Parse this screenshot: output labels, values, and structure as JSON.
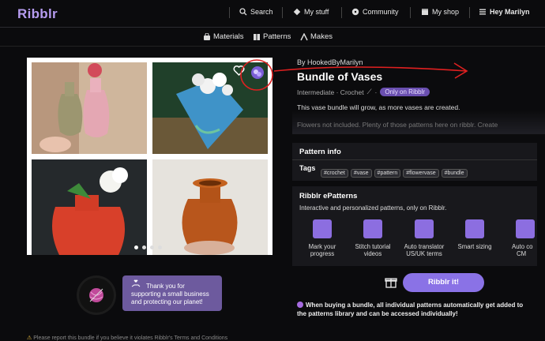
{
  "app": {
    "logo": "Ribblr"
  },
  "topnav": [
    {
      "label": "Search",
      "icon": "search-icon"
    },
    {
      "label": "My stuff",
      "icon": "stuff-icon"
    },
    {
      "label": "Community",
      "icon": "chat-icon"
    },
    {
      "label": "My shop",
      "icon": "shop-icon"
    },
    {
      "label": "Hey Marilyn",
      "icon": "menu-icon"
    }
  ],
  "subnav": [
    {
      "label": "Materials",
      "icon": "bag-icon"
    },
    {
      "label": "Patterns",
      "icon": "book-icon"
    },
    {
      "label": "Makes",
      "icon": "makes-icon"
    }
  ],
  "product": {
    "by": "By HookedByMarilyn",
    "title": "Bundle of Vases",
    "level": "Intermediate · Crochet",
    "exclusive": "Only on Ribblr",
    "description": "This vase bundle will grow, as more vases are created.",
    "description_more": "Flowers not included. Plenty of those patterns here on ribblr. Create"
  },
  "pattern_info": {
    "header": "Pattern info",
    "tags_label": "Tags",
    "tags": [
      "#crochet",
      "#vase",
      "#pattern",
      "#flowervase",
      "#bundle"
    ]
  },
  "epatterns": {
    "header": "Ribblr ePatterns",
    "subtitle": "Interactive and personalized patterns, only on Ribblr.",
    "features": [
      {
        "l1": "Mark your",
        "l2": "progress",
        "icon": "list-icon"
      },
      {
        "l1": "Stitch tutorial",
        "l2": "videos",
        "icon": "video-icon"
      },
      {
        "l1": "Auto translator",
        "l2": "US/UK terms",
        "icon": "translate-icon"
      },
      {
        "l1": "Smart sizing",
        "l2": "",
        "icon": "sizing-icon"
      },
      {
        "l1": "Auto co",
        "l2": "CM",
        "icon": "convert-icon"
      }
    ]
  },
  "cta": {
    "label": "Ribblr it!"
  },
  "bundle_note": "When buying a bundle, all individual patterns automatically get added to the patterns library and can be accessed individually!",
  "thanks": {
    "line1": "Thank you for",
    "line2": "supporting a small business",
    "line3": "and protecting our planet!"
  },
  "report": "Please report this bundle if you believe it violates Ribblr's Terms and Conditions",
  "colors": {
    "accent": "#8a72e6",
    "logo": "#b69cf0",
    "annotation": "#e02020"
  }
}
